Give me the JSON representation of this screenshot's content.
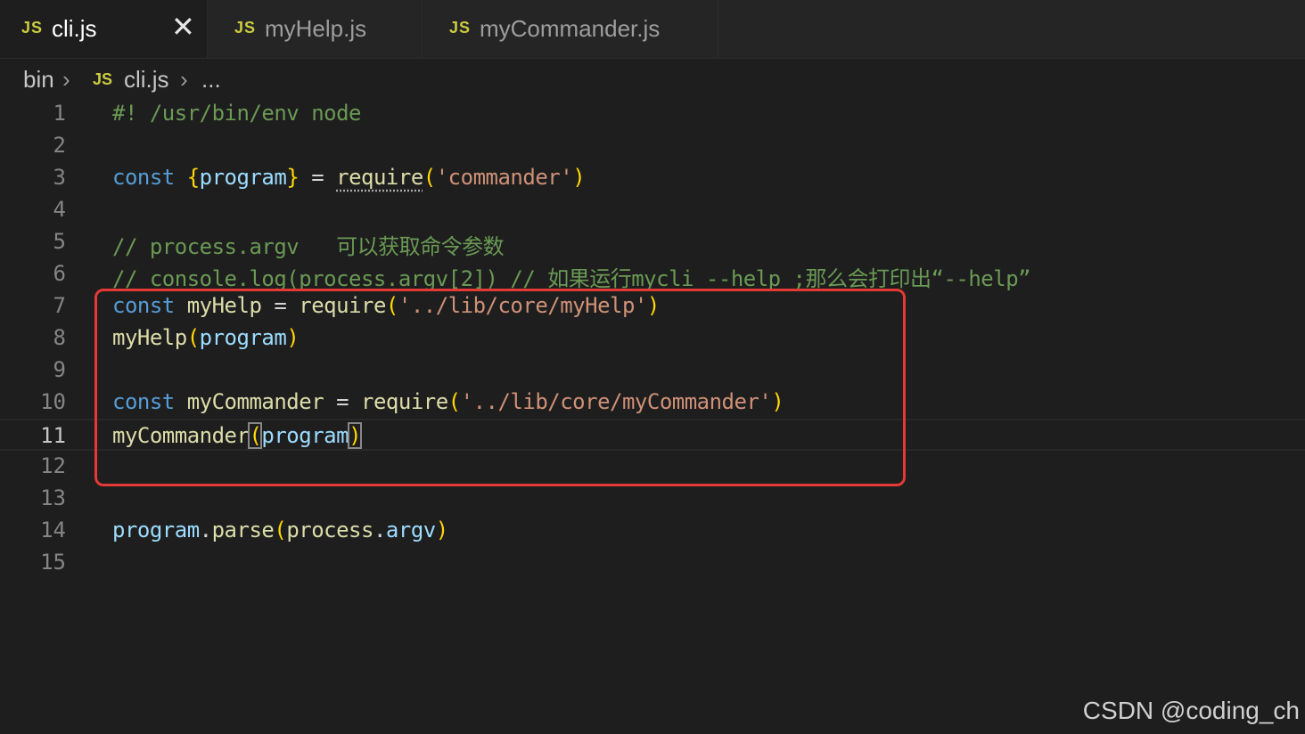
{
  "tabs": [
    {
      "icon": "JS",
      "label": "cli.js",
      "active": true,
      "close": "✕"
    },
    {
      "icon": "JS",
      "label": "myHelp.js",
      "active": false
    },
    {
      "icon": "JS",
      "label": "myCommander.js",
      "active": false
    }
  ],
  "breadcrumb": {
    "folder": "bin",
    "sep": "›",
    "icon": "JS",
    "file": "cli.js",
    "more": "..."
  },
  "editor": {
    "current_line": 11,
    "lines": [
      {
        "n": "1",
        "tokens": [
          {
            "t": "#! /usr/bin/env node",
            "c": "cm"
          }
        ]
      },
      {
        "n": "2",
        "tokens": []
      },
      {
        "n": "3",
        "tokens": [
          {
            "t": "const ",
            "c": "kw"
          },
          {
            "t": "{",
            "c": "br"
          },
          {
            "t": "program",
            "c": "var"
          },
          {
            "t": "}",
            "c": "br"
          },
          {
            "t": " = ",
            "c": "plain"
          },
          {
            "t": "require",
            "c": "fn dots"
          },
          {
            "t": "(",
            "c": "br"
          },
          {
            "t": "'commander'",
            "c": "str"
          },
          {
            "t": ")",
            "c": "br"
          }
        ]
      },
      {
        "n": "4",
        "tokens": []
      },
      {
        "n": "5",
        "tokens": [
          {
            "t": "// process.argv   可以获取命令参数",
            "c": "cm"
          }
        ]
      },
      {
        "n": "6",
        "tokens": [
          {
            "t": "// console.log(process.argv[2]) // 如果运行mycli --help ;那么会打印出“--help”",
            "c": "cm"
          }
        ]
      },
      {
        "n": "7",
        "tokens": [
          {
            "t": "const ",
            "c": "kw"
          },
          {
            "t": "myHelp",
            "c": "fn"
          },
          {
            "t": " = ",
            "c": "plain"
          },
          {
            "t": "require",
            "c": "fn"
          },
          {
            "t": "(",
            "c": "br"
          },
          {
            "t": "'../lib/core/myHelp'",
            "c": "str"
          },
          {
            "t": ")",
            "c": "br"
          }
        ]
      },
      {
        "n": "8",
        "tokens": [
          {
            "t": "myHelp",
            "c": "fn"
          },
          {
            "t": "(",
            "c": "br"
          },
          {
            "t": "program",
            "c": "var"
          },
          {
            "t": ")",
            "c": "br"
          }
        ]
      },
      {
        "n": "9",
        "tokens": []
      },
      {
        "n": "10",
        "tokens": [
          {
            "t": "const ",
            "c": "kw"
          },
          {
            "t": "myCommander",
            "c": "fn"
          },
          {
            "t": " = ",
            "c": "plain"
          },
          {
            "t": "require",
            "c": "fn"
          },
          {
            "t": "(",
            "c": "br"
          },
          {
            "t": "'../lib/core/myCommander'",
            "c": "str"
          },
          {
            "t": ")",
            "c": "br"
          }
        ]
      },
      {
        "n": "11",
        "tokens": [
          {
            "t": "myCommander",
            "c": "fn"
          },
          {
            "t": "(",
            "c": "br boxbr"
          },
          {
            "t": "program",
            "c": "var"
          },
          {
            "t": ")",
            "c": "br boxbr"
          }
        ]
      },
      {
        "n": "12",
        "tokens": []
      },
      {
        "n": "13",
        "tokens": []
      },
      {
        "n": "14",
        "tokens": [
          {
            "t": "program",
            "c": "var"
          },
          {
            "t": ".",
            "c": "plain"
          },
          {
            "t": "parse",
            "c": "fn"
          },
          {
            "t": "(",
            "c": "br"
          },
          {
            "t": "process",
            "c": "fn"
          },
          {
            "t": ".",
            "c": "plain"
          },
          {
            "t": "argv",
            "c": "var"
          },
          {
            "t": ")",
            "c": "br"
          }
        ]
      },
      {
        "n": "15",
        "tokens": []
      }
    ]
  },
  "colors": {
    "highlight_box": "#e53935",
    "background": "#1e1e1e",
    "tabbar": "#252526"
  },
  "watermark": "CSDN @coding_ch"
}
